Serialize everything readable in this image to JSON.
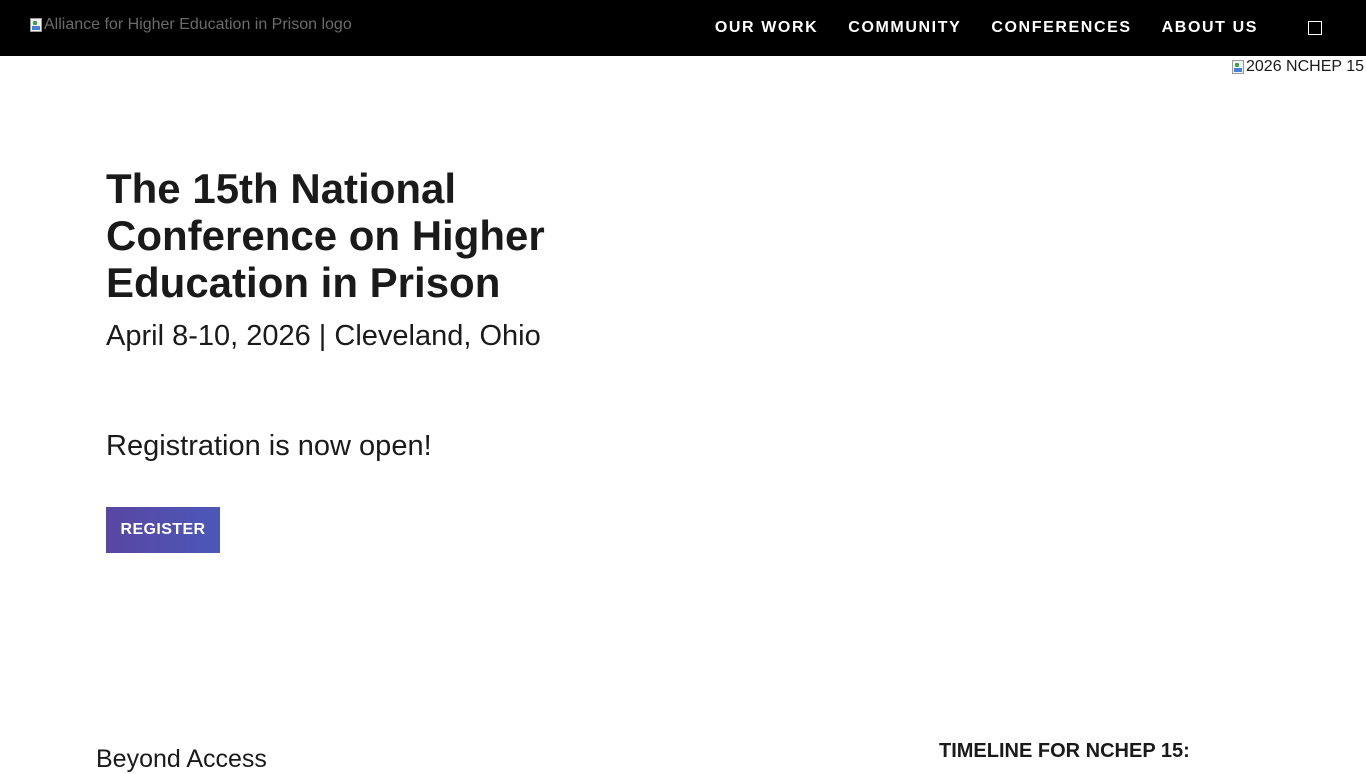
{
  "header": {
    "logo_alt": "Alliance for Higher Education in Prison logo",
    "nav": [
      {
        "label": "OUR WORK"
      },
      {
        "label": "COMMUNITY"
      },
      {
        "label": "CONFERENCES"
      },
      {
        "label": "ABOUT US"
      }
    ],
    "search_icon": "search-icon"
  },
  "hero": {
    "image_alt": "2026 NCHEP 15",
    "title": "The 15th National Conference on Higher Education in Prison",
    "date_location": "April 8-10, 2026 | Cleveland, Ohio",
    "registration_text": "Registration is now open!",
    "register_label": "REGISTER"
  },
  "sections": {
    "left_heading": "Beyond Access",
    "timeline_heading": "TIMELINE FOR NCHEP 15:"
  },
  "colors": {
    "topbar_bg": "#000000",
    "button_accent": "#5a46a3"
  }
}
